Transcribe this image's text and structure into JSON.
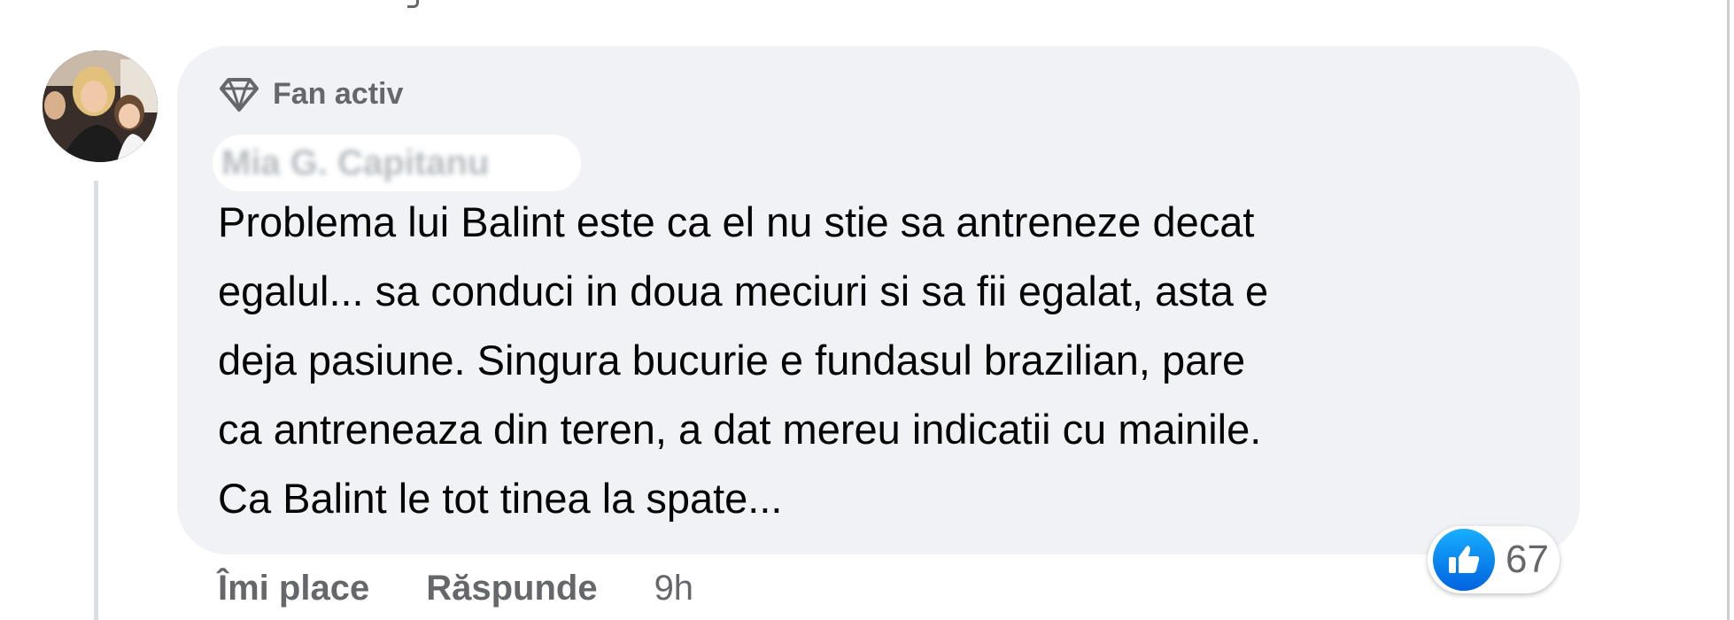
{
  "comment": {
    "badge_label": "Fan activ",
    "badge_icon": "diamond-icon",
    "author_name": "Mia G. Capitanu",
    "text_lines": [
      "Problema lui Balint este ca el nu stie sa antreneze decat",
      "egalul... sa conduci in doua meciuri si sa fii egalat, asta e",
      "deja pasiune. Singura bucurie e fundasul brazilian, pare",
      "ca antreneaza din teren, a dat mereu indicatii cu mainile.",
      "Ca Balint le tot tinea la spate..."
    ],
    "reactions": {
      "icon": "thumbs-up-icon",
      "count": "67",
      "color": "#1877f2"
    },
    "actions": {
      "like_label": "Îmi place",
      "reply_label": "Răspunde",
      "time": "9h"
    }
  },
  "colors": {
    "bubble": "#f0f2f5",
    "text": "#050505",
    "secondary": "#65676b"
  }
}
